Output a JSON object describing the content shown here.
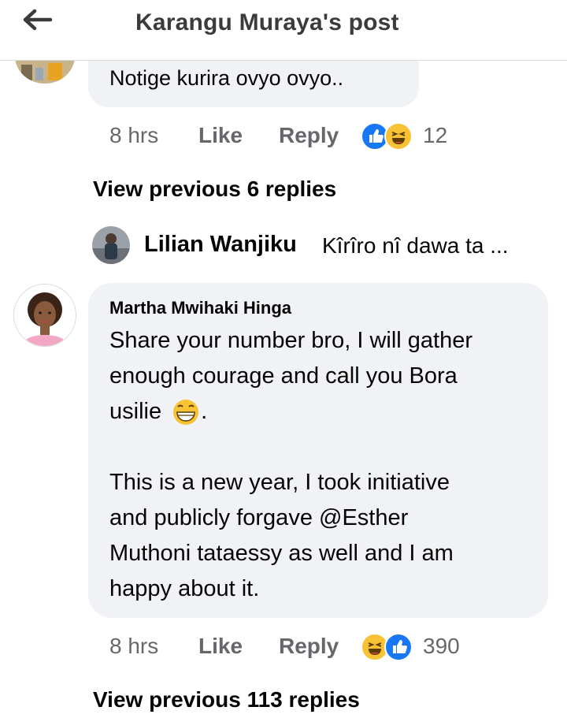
{
  "header": {
    "title": "Karangu Muraya's post"
  },
  "top_comment": {
    "text": "Notige kurira ovyo ovyo..",
    "time": "8 hrs",
    "like_label": "Like",
    "reply_label": "Reply",
    "reaction_count": "12",
    "reactions": [
      "like-icon",
      "haha-icon"
    ]
  },
  "view_previous_1": "View previous 6 replies",
  "reply_preview": {
    "name": "Lilian Wanjiku",
    "text": "Kîrîro nî dawa ta ..."
  },
  "main_comment": {
    "name": "Martha Mwihaki Hinga",
    "line1": "Share your number bro, I will gather",
    "line2": "enough courage and call you Bora",
    "line3": "usilie",
    "line3_end": ".",
    "line4": "This is a new year, I took initiative",
    "line5": "and publicly forgave @Esther",
    "line6": "Muthoni tataessy as well and I am",
    "line7": "happy about it.",
    "time": "8 hrs",
    "like_label": "Like",
    "reply_label": "Reply",
    "reaction_count": "390",
    "reactions": [
      "haha-icon",
      "like-icon"
    ]
  },
  "view_previous_2": "View previous 113 replies",
  "colors": {
    "like_blue": "#1877f2",
    "haha_yellow": "#f7c234",
    "bubble": "#f0f2f5",
    "meta_gray": "#65676b"
  }
}
